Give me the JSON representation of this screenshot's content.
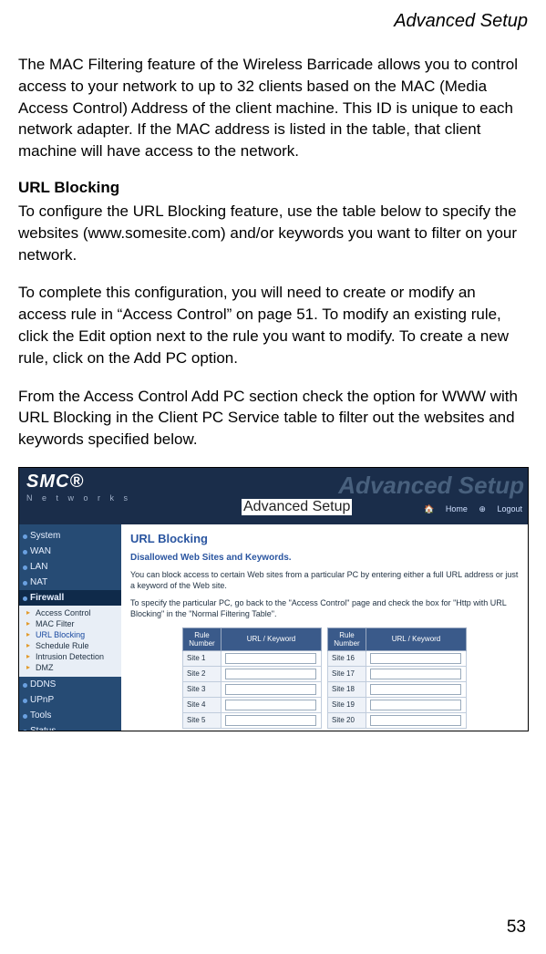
{
  "page": {
    "header": "Advanced Setup",
    "p1": "The MAC Filtering feature of the Wireless Barricade allows you to control access to your network to up to 32 clients based on the MAC (Media Access Control) Address of the client machine. This ID is unique to each network adapter. If the MAC address is listed in the table, that client machine will have access to the network.",
    "h_url": "URL Blocking",
    "p2": "To configure the URL Blocking feature, use the table below to specify the websites (www.somesite.com) and/or keywords you want to filter on your network.",
    "p3": "To complete this configuration, you will need to create or modify an access rule in “Access Control” on page 51. To modify an existing rule, click the Edit option next to the rule you want to modify. To create a new rule, click on the Add PC option.",
    "p4": "From the Access Control Add PC section check the option for WWW with URL Blocking in the Client PC Service table to filter out the websites and keywords specified below.",
    "pagenum": "53"
  },
  "screenshot": {
    "logo": "SMC®",
    "logo_sub": "N e t w o r k s",
    "ghost": "Advanced Setup",
    "title_overlay": "Advanced Setup",
    "tab_home": "Home",
    "tab_logout": "Logout",
    "sidebar": {
      "items": [
        {
          "label": "System"
        },
        {
          "label": "WAN"
        },
        {
          "label": "LAN"
        },
        {
          "label": "NAT"
        },
        {
          "label": "Firewall"
        },
        {
          "label": "DDNS"
        },
        {
          "label": "UPnP"
        },
        {
          "label": "Tools"
        },
        {
          "label": "Status"
        }
      ],
      "firewall_sub": [
        {
          "label": "Access Control"
        },
        {
          "label": "MAC Filter"
        },
        {
          "label": "URL Blocking"
        },
        {
          "label": "Schedule Rule"
        },
        {
          "label": "Intrusion Detection"
        },
        {
          "label": "DMZ"
        }
      ]
    },
    "main": {
      "title": "URL Blocking",
      "subtitle": "Disallowed Web Sites and Keywords.",
      "p1": "You can block access to certain Web sites from a particular PC by entering either a full URL address or just a keyword of the Web site.",
      "p2": "To specify the particular PC, go back to the \"Access Control\" page and check the box for \"Http with URL Blocking\" in the \"Normal Filtering Table\".",
      "th_rule": "Rule Number",
      "th_url": "URL / Keyword",
      "rows_left": [
        "Site  1",
        "Site  2",
        "Site  3",
        "Site  4",
        "Site  5"
      ],
      "rows_right": [
        "Site  16",
        "Site  17",
        "Site  18",
        "Site  19",
        "Site  20"
      ]
    }
  }
}
